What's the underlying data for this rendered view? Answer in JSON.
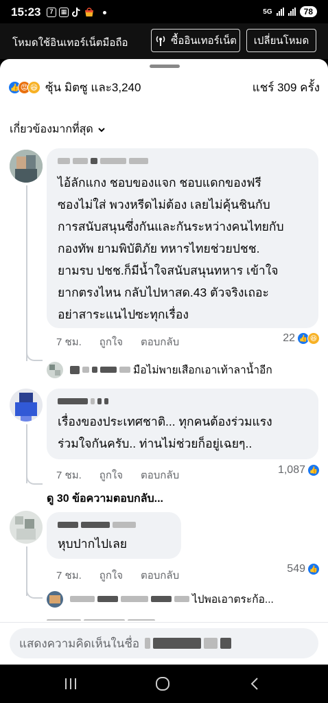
{
  "status_bar": {
    "time": "15:23",
    "left_icons": [
      "calendar-icon",
      "grid-icon",
      "tiktok-icon",
      "shopee-icon"
    ],
    "network": "5G",
    "battery": "78"
  },
  "data_mode_bar": {
    "title": "โหมดใช้อินเทอร์เน็ตมือถือ",
    "buy_button": "ซื้ออินเทอร์เน็ต",
    "switch_button": "เปลี่ยนโหมด"
  },
  "post_summary": {
    "reactions_text": "ซุ้น มิตซู และ3,240",
    "shares_text": "แชร์ 309 ครั้ง",
    "reaction_icons": [
      "like-icon",
      "angry-icon",
      "haha-icon"
    ]
  },
  "sort": {
    "label": "เกี่ยวข้องมากที่สุด"
  },
  "comments": [
    {
      "text": "ไอ้ลักแกง ชอบของแจก ชอบแดกของฟรี\nซองไม่ใส่ พวงหรีดไม่ต้อง เลยไม่คุ้นชินกับ\nการสนับสนุนซึ่งกันและกันระหว่างคนไทยกับ\nกองทัพ ยามพิบัติภัย ทหารไทยช่วยปชช.\nยามรบ ปชช.ก็มีน้ำใจสนับสนุนทหาร เข้าใจ\nยากตรงไหน กลับไปหาสด.43 ตัวจริงเถอะ\nอย่าสาระแนไปซะทุกเรื่อง",
      "time": "7 ชม.",
      "like": "ถูกใจ",
      "reply": "ตอบกลับ",
      "count": "22",
      "reply_preview": "มือไม่พายเสือกเอาเท้าลาน้ำอีก"
    },
    {
      "text": "เรื่องของประเทศชาติ... ทุกคนต้องร่วมแรง\nร่วมใจกันครับ.. ท่านไม่ช่วยก็อยู่เฉยๆ..",
      "time": "7 ชม.",
      "like": "ถูกใจ",
      "reply": "ตอบกลับ",
      "count": "1,087",
      "view_replies": "ดู 30 ข้อความตอบกลับ..."
    },
    {
      "text": "หุบปากไปเลย",
      "time": "7 ชม.",
      "like": "ถูกใจ",
      "reply": "ตอบกลับ",
      "count": "549",
      "reply_preview": "ไปพอเอาตระก้อ..."
    }
  ],
  "composer": {
    "placeholder": "แสดงความคิดเห็นในชื่อ"
  },
  "colors": {
    "like_blue": "#1877f2",
    "bubble_bg": "#f0f2f5",
    "meta_gray": "#65676b"
  },
  "nav_bar": {
    "icons": [
      "recents-icon",
      "home-icon",
      "back-icon"
    ]
  }
}
